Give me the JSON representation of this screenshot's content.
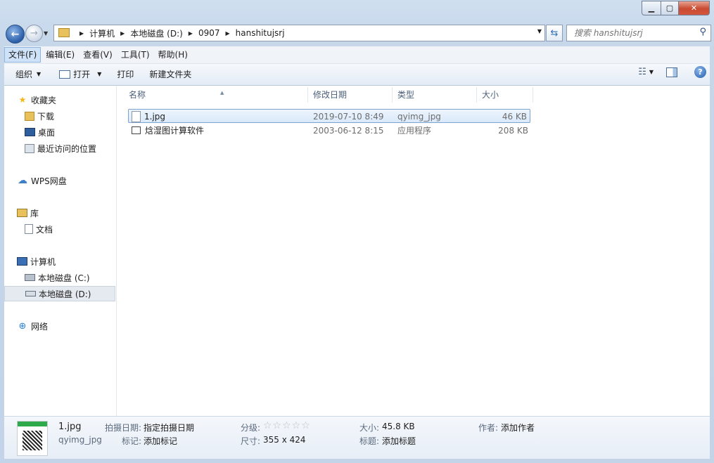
{
  "breadcrumb": [
    "计算机",
    "本地磁盘 (D:)",
    "0907",
    "hanshitujsrj"
  ],
  "search": {
    "placeholder": "搜索 hanshitujsrj"
  },
  "menu": [
    "文件(F)",
    "编辑(E)",
    "查看(V)",
    "工具(T)",
    "帮助(H)"
  ],
  "toolbar": {
    "organize": "组织",
    "open": "打开",
    "print": "打印",
    "new_folder": "新建文件夹"
  },
  "nav": {
    "favorites": "收藏夹",
    "downloads": "下载",
    "desktop": "桌面",
    "recent": "最近访问的位置",
    "wps": "WPS网盘",
    "library": "库",
    "documents": "文档",
    "computer": "计算机",
    "drive_c": "本地磁盘 (C:)",
    "drive_d": "本地磁盘 (D:)",
    "network": "网络"
  },
  "columns": {
    "name": "名称",
    "date": "修改日期",
    "type": "类型",
    "size": "大小"
  },
  "files": [
    {
      "name": "1.jpg",
      "date": "2019-07-10 8:49",
      "type": "qyimg_jpg",
      "size": "46 KB"
    },
    {
      "name": "焓湿图计算软件",
      "date": "2003-06-12 8:15",
      "type": "应用程序",
      "size": "208 KB"
    }
  ],
  "details": {
    "filename": "1.jpg",
    "filetype": "qyimg_jpg",
    "shot_date_label": "拍摄日期:",
    "shot_date_value": "指定拍摄日期",
    "tags_label": "标记:",
    "tags_value": "添加标记",
    "rating_label": "分级:",
    "rating_stars": "☆☆☆☆☆",
    "dimensions_label": "尺寸:",
    "dimensions_value": "355 x 424",
    "size_label": "大小:",
    "size_value": "45.8 KB",
    "title_label": "标题:",
    "title_value": "添加标题",
    "author_label": "作者:",
    "author_value": "添加作者"
  },
  "colors": {
    "selection": "#d9e9fb",
    "selection_border": "#7da2ce",
    "close_button": "#c94a31"
  }
}
